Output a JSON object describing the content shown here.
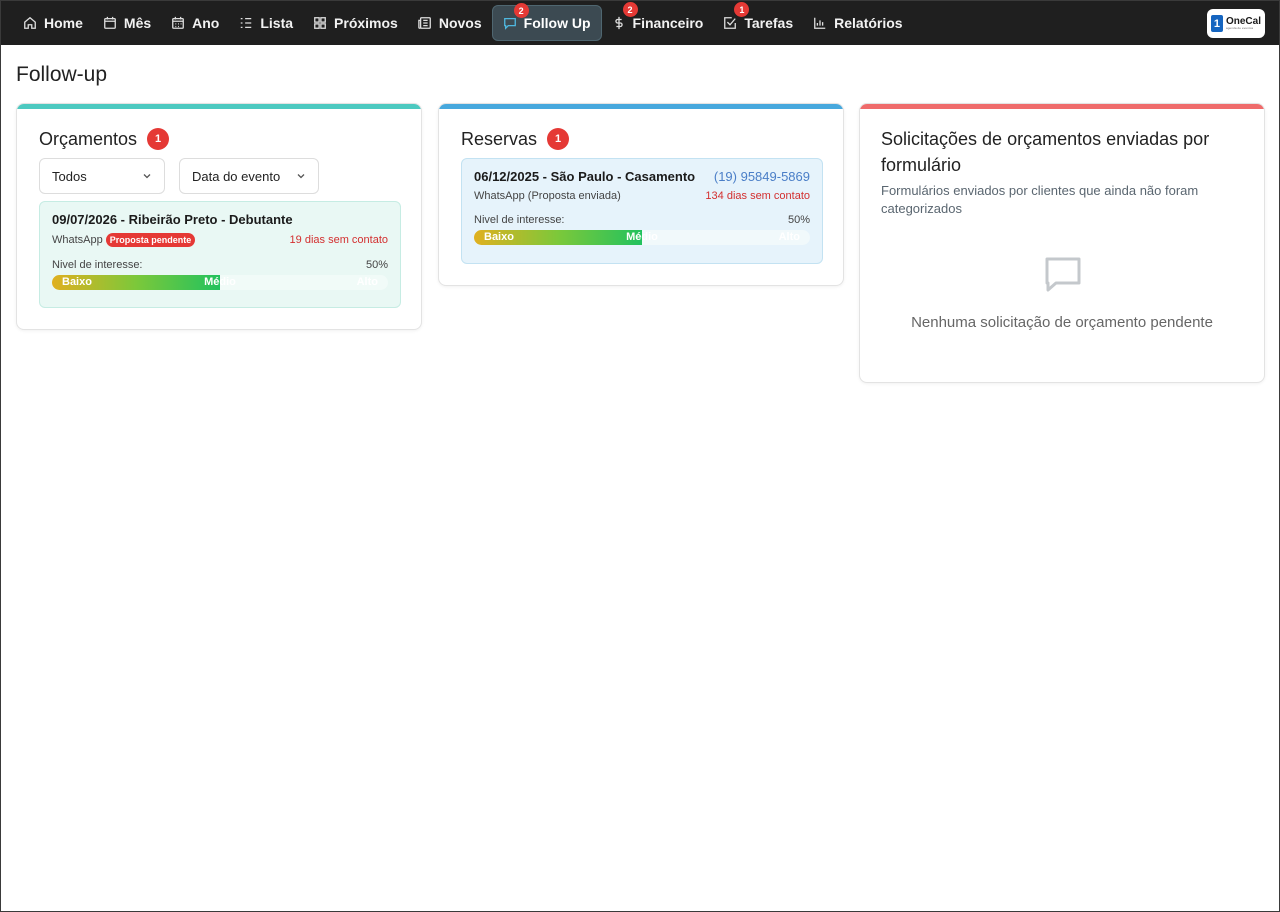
{
  "nav": {
    "items": [
      {
        "label": "Home",
        "icon": "home-icon"
      },
      {
        "label": "Mês",
        "icon": "calendar-icon"
      },
      {
        "label": "Ano",
        "icon": "calendar-grid-icon"
      },
      {
        "label": "Lista",
        "icon": "list-icon"
      },
      {
        "label": "Próximos",
        "icon": "grid-icon"
      },
      {
        "label": "Novos",
        "icon": "newspaper-icon"
      },
      {
        "label": "Follow Up",
        "icon": "chat-icon",
        "badge": "2",
        "active": true
      },
      {
        "label": "Financeiro",
        "icon": "dollar-icon",
        "badge": "2"
      },
      {
        "label": "Tarefas",
        "icon": "checkbox-icon",
        "badge": "1"
      },
      {
        "label": "Relatórios",
        "icon": "bar-chart-icon"
      }
    ],
    "logo": {
      "mark": "1",
      "name": "OneCal",
      "tag": "agenda de eventos"
    }
  },
  "page": {
    "title": "Follow-up"
  },
  "orcamentos": {
    "title": "Orçamentos",
    "count": "1",
    "filter_status": "Todos",
    "filter_sort": "Data do evento",
    "item": {
      "title": "09/07/2026 - Ribeirão Preto - Debutante",
      "channel": "WhatsApp",
      "status": "Proposta pendente",
      "days": "19 dias sem contato",
      "interest_label": "Nivel de interesse:",
      "interest_value": "50%",
      "interest_fraction": 0.5,
      "scale": [
        "Baixo",
        "Médio",
        "Alto"
      ]
    }
  },
  "reservas": {
    "title": "Reservas",
    "count": "1",
    "item": {
      "title": "06/12/2025 - São Paulo - Casamento",
      "phone": "(19) 95849-5869",
      "channel": "WhatsApp (Proposta enviada)",
      "days": "134 dias sem contato",
      "interest_label": "Nivel de interesse:",
      "interest_value": "50%",
      "interest_fraction": 0.5,
      "scale": [
        "Baixo",
        "Médio",
        "Alto"
      ]
    }
  },
  "solicitacoes": {
    "title": "Solicitações de orçamentos enviadas por formulário",
    "subtitle": "Formulários enviados por clientes que ainda não foram categorizados",
    "empty": "Nenhuma solicitação de orçamento pendente"
  }
}
